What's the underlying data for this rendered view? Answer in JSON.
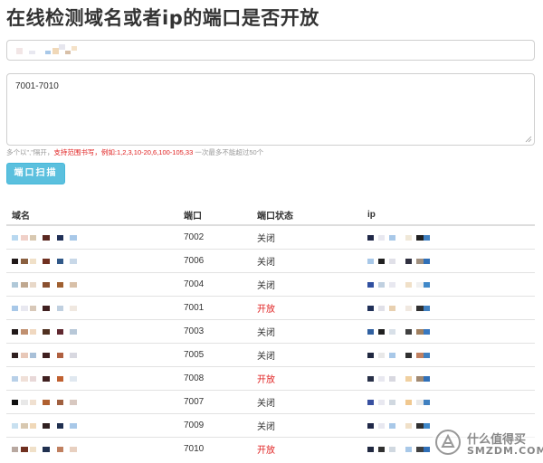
{
  "title": "在线检测域名或者ip的端口是否开放",
  "domain_input": {
    "value": ""
  },
  "ports_input": {
    "value": "7001-7010"
  },
  "hint": {
    "before": "多个以\",\"隔开，",
    "highlight": "支持范围书写，例如:1,2,3,10-20,6,100-105,33",
    "after": " 一次最多不能超过50个"
  },
  "scan_button": {
    "label": "端口扫描"
  },
  "table": {
    "headers": [
      "域名",
      "端口",
      "端口状态",
      "ip"
    ],
    "rows": [
      {
        "port": "7002",
        "status": "关闭",
        "open": false
      },
      {
        "port": "7006",
        "status": "关闭",
        "open": false
      },
      {
        "port": "7004",
        "status": "关闭",
        "open": false
      },
      {
        "port": "7001",
        "status": "开放",
        "open": true
      },
      {
        "port": "7003",
        "status": "关闭",
        "open": false
      },
      {
        "port": "7005",
        "status": "关闭",
        "open": false
      },
      {
        "port": "7008",
        "status": "开放",
        "open": true
      },
      {
        "port": "7007",
        "status": "关闭",
        "open": false
      },
      {
        "port": "7009",
        "status": "关闭",
        "open": false
      },
      {
        "port": "7010",
        "status": "开放",
        "open": true
      }
    ]
  },
  "colors": {
    "button": "#5bc0de",
    "open_status": "#e02020",
    "hint_highlight": "#e02020"
  },
  "watermark": {
    "line1": "什么值得买",
    "line2": "SMZDM.COM"
  }
}
